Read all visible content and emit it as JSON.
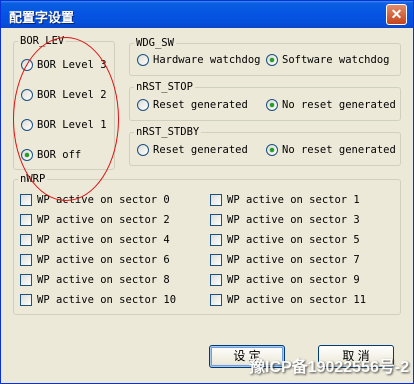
{
  "window": {
    "title": "配置字设置",
    "close_glyph": "✕"
  },
  "bor": {
    "legend": "BOR_LEV",
    "options": [
      {
        "label": "BOR Level 3",
        "selected": false
      },
      {
        "label": "BOR Level 2",
        "selected": false
      },
      {
        "label": "BOR Level 1",
        "selected": false
      },
      {
        "label": "BOR off",
        "selected": true
      }
    ]
  },
  "wdg": {
    "legend": "WDG_SW",
    "opt1": "Hardware watchdog",
    "opt2": "Software watchdog",
    "selected": "opt2"
  },
  "stop": {
    "legend": "nRST_STOP",
    "opt1": "Reset generated",
    "opt2": "No reset generated",
    "selected": "opt2"
  },
  "stdby": {
    "legend": "nRST_STDBY",
    "opt1": "Reset generated",
    "opt2": "No reset generated",
    "selected": "opt2"
  },
  "nwrp": {
    "legend": "nWRP",
    "sectors": [
      "WP active on sector 0",
      "WP active on sector 1",
      "WP active on sector 2",
      "WP active on sector 3",
      "WP active on sector 4",
      "WP active on sector 5",
      "WP active on sector 6",
      "WP active on sector 7",
      "WP active on sector 8",
      "WP active on sector 9",
      "WP active on sector 10",
      "WP active on sector 11"
    ]
  },
  "buttons": {
    "ok": "设 定",
    "cancel": "取 消"
  },
  "watermark": "豫ICP备19022556号-2"
}
